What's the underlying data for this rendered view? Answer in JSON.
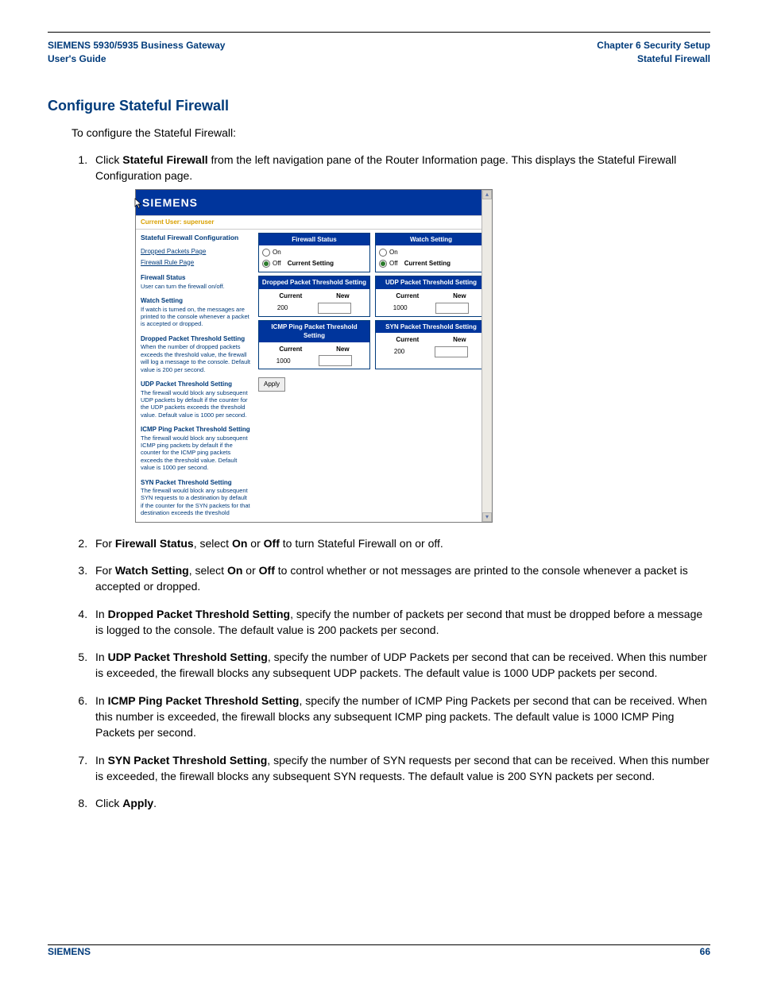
{
  "header": {
    "left_line1": "SIEMENS 5930/5935 Business Gateway",
    "left_line2": "User's Guide",
    "right_line1": "Chapter 6  Security Setup",
    "right_line2": "Stateful Firewall"
  },
  "section_title": "Configure Stateful Firewall",
  "intro": "To configure the Stateful Firewall:",
  "steps": {
    "s1_pre": "Click ",
    "s1_b": "Stateful Firewall",
    "s1_post": " from the left navigation pane of the Router Information page. This displays the Stateful Firewall Configuration page.",
    "s2_pre": "For ",
    "s2_b1": "Firewall Status",
    "s2_mid1": ", select ",
    "s2_b2": "On",
    "s2_mid2": " or ",
    "s2_b3": "Off",
    "s2_post": " to turn Stateful Firewall on or off.",
    "s3_pre": "For ",
    "s3_b1": "Watch Setting",
    "s3_mid1": ", select ",
    "s3_b2": "On",
    "s3_mid2": " or ",
    "s3_b3": "Off",
    "s3_post": " to control whether or not messages are printed to the console whenever a packet is accepted or dropped.",
    "s4_pre": "In ",
    "s4_b": "Dropped Packet Threshold Setting",
    "s4_post": ", specify the number of packets per second that must be dropped before a message is logged to the console. The default value is 200 packets per second.",
    "s5_pre": "In ",
    "s5_b": "UDP Packet Threshold Setting",
    "s5_post": ", specify the number of UDP Packets per second that can be received. When this number is exceeded, the firewall blocks any subsequent UDP packets. The default value is 1000 UDP packets per second.",
    "s6_pre": "In ",
    "s6_b": "ICMP Ping Packet Threshold Setting",
    "s6_post": ", specify the number of ICMP Ping Packets per second that can be received. When this number is exceeded, the firewall blocks any subsequent ICMP ping packets. The default value is 1000 ICMP Ping Packets per second.",
    "s7_pre": "In ",
    "s7_b": "SYN Packet Threshold Setting",
    "s7_post": ", specify the number of SYN requests per second that can be received. When this number is exceeded, the firewall blocks any subsequent SYN requests. The default value is 200 SYN packets per second.",
    "s8_pre": "Click ",
    "s8_b": "Apply",
    "s8_post": "."
  },
  "screenshot": {
    "brand": "SIEMENS",
    "user_line": "Current User: superuser",
    "sidebar": {
      "title": "Stateful Firewall Configuration",
      "link1": "Dropped Packets Page",
      "link2": "Firewall Rule Page",
      "sec1_h": "Firewall Status",
      "sec1_t": "User can turn the firewall on/off.",
      "sec2_h": "Watch Setting",
      "sec2_t": "If watch is turned on, the messages are printed to the console whenever a packet is accepted or dropped.",
      "sec3_h": "Dropped Packet Threshold Setting",
      "sec3_t": "When the number of dropped packets exceeds the threshold value, the firewall will log a message to the console. Default value is 200 per second.",
      "sec4_h": "UDP Packet Threshold Setting",
      "sec4_t": "The firewall would block any subsequent UDP packets by default if the counter for the UDP packets exceeds the threshold value. Default value is 1000 per second.",
      "sec5_h": "ICMP Ping Packet Threshold Setting",
      "sec5_t": "The firewall would block any subsequent ICMP ping packets by default if the counter for the ICMP ping packets exceeds the threshold value. Default value is 1000 per second.",
      "sec6_h": "SYN Packet Threshold Setting",
      "sec6_t": "The firewall would block any subsequent SYN requests to a destination by default if the counter for the SYN packets for that destination exceeds the threshold"
    },
    "panels": {
      "firewall_status": "Firewall Status",
      "watch_setting": "Watch Setting",
      "on": "On",
      "off": "Off",
      "current_setting": "Current Setting",
      "dropped": "Dropped Packet Threshold Setting",
      "udp": "UDP Packet Threshold Setting",
      "icmp": "ICMP Ping Packet Threshold Setting",
      "syn": "SYN Packet Threshold Setting",
      "current": "Current",
      "new": "New",
      "v200": "200",
      "v1000": "1000",
      "apply": "Apply"
    }
  },
  "footer": {
    "left": "SIEMENS",
    "right": "66"
  }
}
